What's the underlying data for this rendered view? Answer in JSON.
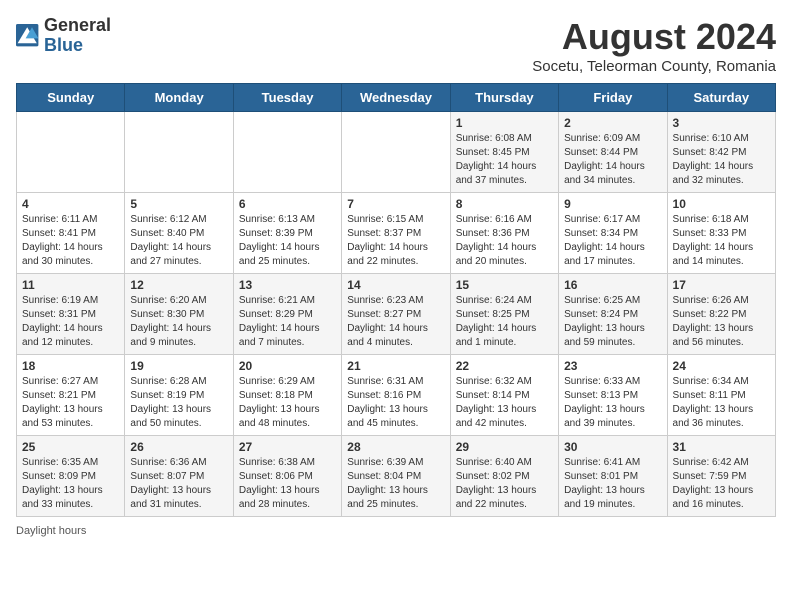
{
  "header": {
    "logo_general": "General",
    "logo_blue": "Blue",
    "title": "August 2024",
    "subtitle": "Socetu, Teleorman County, Romania"
  },
  "days_of_week": [
    "Sunday",
    "Monday",
    "Tuesday",
    "Wednesday",
    "Thursday",
    "Friday",
    "Saturday"
  ],
  "weeks": [
    [
      {
        "day": "",
        "info": ""
      },
      {
        "day": "",
        "info": ""
      },
      {
        "day": "",
        "info": ""
      },
      {
        "day": "",
        "info": ""
      },
      {
        "day": "1",
        "info": "Sunrise: 6:08 AM\nSunset: 8:45 PM\nDaylight: 14 hours\nand 37 minutes."
      },
      {
        "day": "2",
        "info": "Sunrise: 6:09 AM\nSunset: 8:44 PM\nDaylight: 14 hours\nand 34 minutes."
      },
      {
        "day": "3",
        "info": "Sunrise: 6:10 AM\nSunset: 8:42 PM\nDaylight: 14 hours\nand 32 minutes."
      }
    ],
    [
      {
        "day": "4",
        "info": "Sunrise: 6:11 AM\nSunset: 8:41 PM\nDaylight: 14 hours\nand 30 minutes."
      },
      {
        "day": "5",
        "info": "Sunrise: 6:12 AM\nSunset: 8:40 PM\nDaylight: 14 hours\nand 27 minutes."
      },
      {
        "day": "6",
        "info": "Sunrise: 6:13 AM\nSunset: 8:39 PM\nDaylight: 14 hours\nand 25 minutes."
      },
      {
        "day": "7",
        "info": "Sunrise: 6:15 AM\nSunset: 8:37 PM\nDaylight: 14 hours\nand 22 minutes."
      },
      {
        "day": "8",
        "info": "Sunrise: 6:16 AM\nSunset: 8:36 PM\nDaylight: 14 hours\nand 20 minutes."
      },
      {
        "day": "9",
        "info": "Sunrise: 6:17 AM\nSunset: 8:34 PM\nDaylight: 14 hours\nand 17 minutes."
      },
      {
        "day": "10",
        "info": "Sunrise: 6:18 AM\nSunset: 8:33 PM\nDaylight: 14 hours\nand 14 minutes."
      }
    ],
    [
      {
        "day": "11",
        "info": "Sunrise: 6:19 AM\nSunset: 8:31 PM\nDaylight: 14 hours\nand 12 minutes."
      },
      {
        "day": "12",
        "info": "Sunrise: 6:20 AM\nSunset: 8:30 PM\nDaylight: 14 hours\nand 9 minutes."
      },
      {
        "day": "13",
        "info": "Sunrise: 6:21 AM\nSunset: 8:29 PM\nDaylight: 14 hours\nand 7 minutes."
      },
      {
        "day": "14",
        "info": "Sunrise: 6:23 AM\nSunset: 8:27 PM\nDaylight: 14 hours\nand 4 minutes."
      },
      {
        "day": "15",
        "info": "Sunrise: 6:24 AM\nSunset: 8:25 PM\nDaylight: 14 hours\nand 1 minute."
      },
      {
        "day": "16",
        "info": "Sunrise: 6:25 AM\nSunset: 8:24 PM\nDaylight: 13 hours\nand 59 minutes."
      },
      {
        "day": "17",
        "info": "Sunrise: 6:26 AM\nSunset: 8:22 PM\nDaylight: 13 hours\nand 56 minutes."
      }
    ],
    [
      {
        "day": "18",
        "info": "Sunrise: 6:27 AM\nSunset: 8:21 PM\nDaylight: 13 hours\nand 53 minutes."
      },
      {
        "day": "19",
        "info": "Sunrise: 6:28 AM\nSunset: 8:19 PM\nDaylight: 13 hours\nand 50 minutes."
      },
      {
        "day": "20",
        "info": "Sunrise: 6:29 AM\nSunset: 8:18 PM\nDaylight: 13 hours\nand 48 minutes."
      },
      {
        "day": "21",
        "info": "Sunrise: 6:31 AM\nSunset: 8:16 PM\nDaylight: 13 hours\nand 45 minutes."
      },
      {
        "day": "22",
        "info": "Sunrise: 6:32 AM\nSunset: 8:14 PM\nDaylight: 13 hours\nand 42 minutes."
      },
      {
        "day": "23",
        "info": "Sunrise: 6:33 AM\nSunset: 8:13 PM\nDaylight: 13 hours\nand 39 minutes."
      },
      {
        "day": "24",
        "info": "Sunrise: 6:34 AM\nSunset: 8:11 PM\nDaylight: 13 hours\nand 36 minutes."
      }
    ],
    [
      {
        "day": "25",
        "info": "Sunrise: 6:35 AM\nSunset: 8:09 PM\nDaylight: 13 hours\nand 33 minutes."
      },
      {
        "day": "26",
        "info": "Sunrise: 6:36 AM\nSunset: 8:07 PM\nDaylight: 13 hours\nand 31 minutes."
      },
      {
        "day": "27",
        "info": "Sunrise: 6:38 AM\nSunset: 8:06 PM\nDaylight: 13 hours\nand 28 minutes."
      },
      {
        "day": "28",
        "info": "Sunrise: 6:39 AM\nSunset: 8:04 PM\nDaylight: 13 hours\nand 25 minutes."
      },
      {
        "day": "29",
        "info": "Sunrise: 6:40 AM\nSunset: 8:02 PM\nDaylight: 13 hours\nand 22 minutes."
      },
      {
        "day": "30",
        "info": "Sunrise: 6:41 AM\nSunset: 8:01 PM\nDaylight: 13 hours\nand 19 minutes."
      },
      {
        "day": "31",
        "info": "Sunrise: 6:42 AM\nSunset: 7:59 PM\nDaylight: 13 hours\nand 16 minutes."
      }
    ]
  ],
  "footer": {
    "daylight_label": "Daylight hours"
  }
}
